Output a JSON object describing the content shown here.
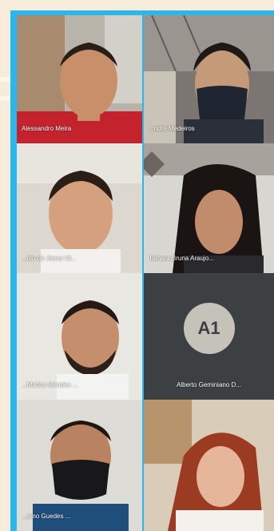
{
  "participants": [
    {
      "name": "Alessandro Meira",
      "type": "video"
    },
    {
      "name": "...ndre Medeiros",
      "type": "video",
      "note": "wearing mask"
    },
    {
      "name": "...dio de Jesus Ol...",
      "type": "video"
    },
    {
      "name": "Tamara Bruna Araujo...",
      "type": "video"
    },
    {
      "name": "...Mattos Mendes ...",
      "type": "video"
    },
    {
      "name": "Alberto Geminiano D...",
      "type": "avatar",
      "initials": "A1"
    },
    {
      "name": "...amo Guedes ...",
      "type": "video",
      "note": "wearing mask"
    },
    {
      "name": "",
      "type": "video"
    }
  ],
  "colors": {
    "background": "#f7ecd9",
    "frame": "#2ab8ec",
    "avatar_tile": "#3c4043",
    "avatar_circle": "#c5c2ba"
  }
}
